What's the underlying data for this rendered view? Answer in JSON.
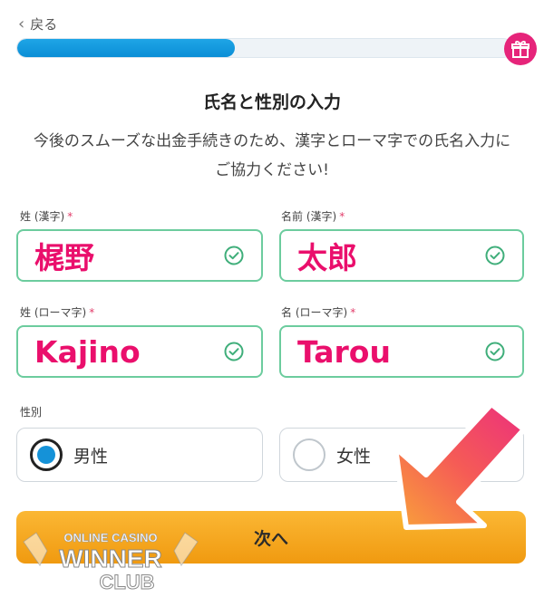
{
  "nav": {
    "back_label": "戻る"
  },
  "progress": {
    "value": 0.44
  },
  "form": {
    "heading": "氏名と性別の入力",
    "description": "今後のスムーズな出金手続きのため、漢字とローマ字での氏名入力にご協力ください!",
    "fields": {
      "last_kanji": {
        "label": "姓 (漢字)",
        "value": "梶野"
      },
      "first_kanji": {
        "label": "名前 (漢字)",
        "value": "太郎"
      },
      "last_roman": {
        "label": "姓 (ローマ字)",
        "value": "Kajino"
      },
      "first_roman": {
        "label": "名 (ローマ字)",
        "value": "Tarou"
      }
    },
    "required_mark": "*",
    "gender": {
      "label": "性別",
      "male": "男性",
      "female": "女性",
      "selected": "male"
    },
    "next_button": "次へ"
  },
  "watermark": {
    "line1": "ONLINE CASINO",
    "line2": "WINNER",
    "line3": "CLUB"
  },
  "colors": {
    "accent_blue": "#1592d8",
    "valid_green": "#3fae7a",
    "entered_text": "#ea0f6c",
    "button_orange": "#f5a623",
    "gift_pink": "#e6247a"
  },
  "icons": [
    "chevron-left-icon",
    "gift-icon",
    "check-circle-icon",
    "arrow-annotation-icon"
  ]
}
